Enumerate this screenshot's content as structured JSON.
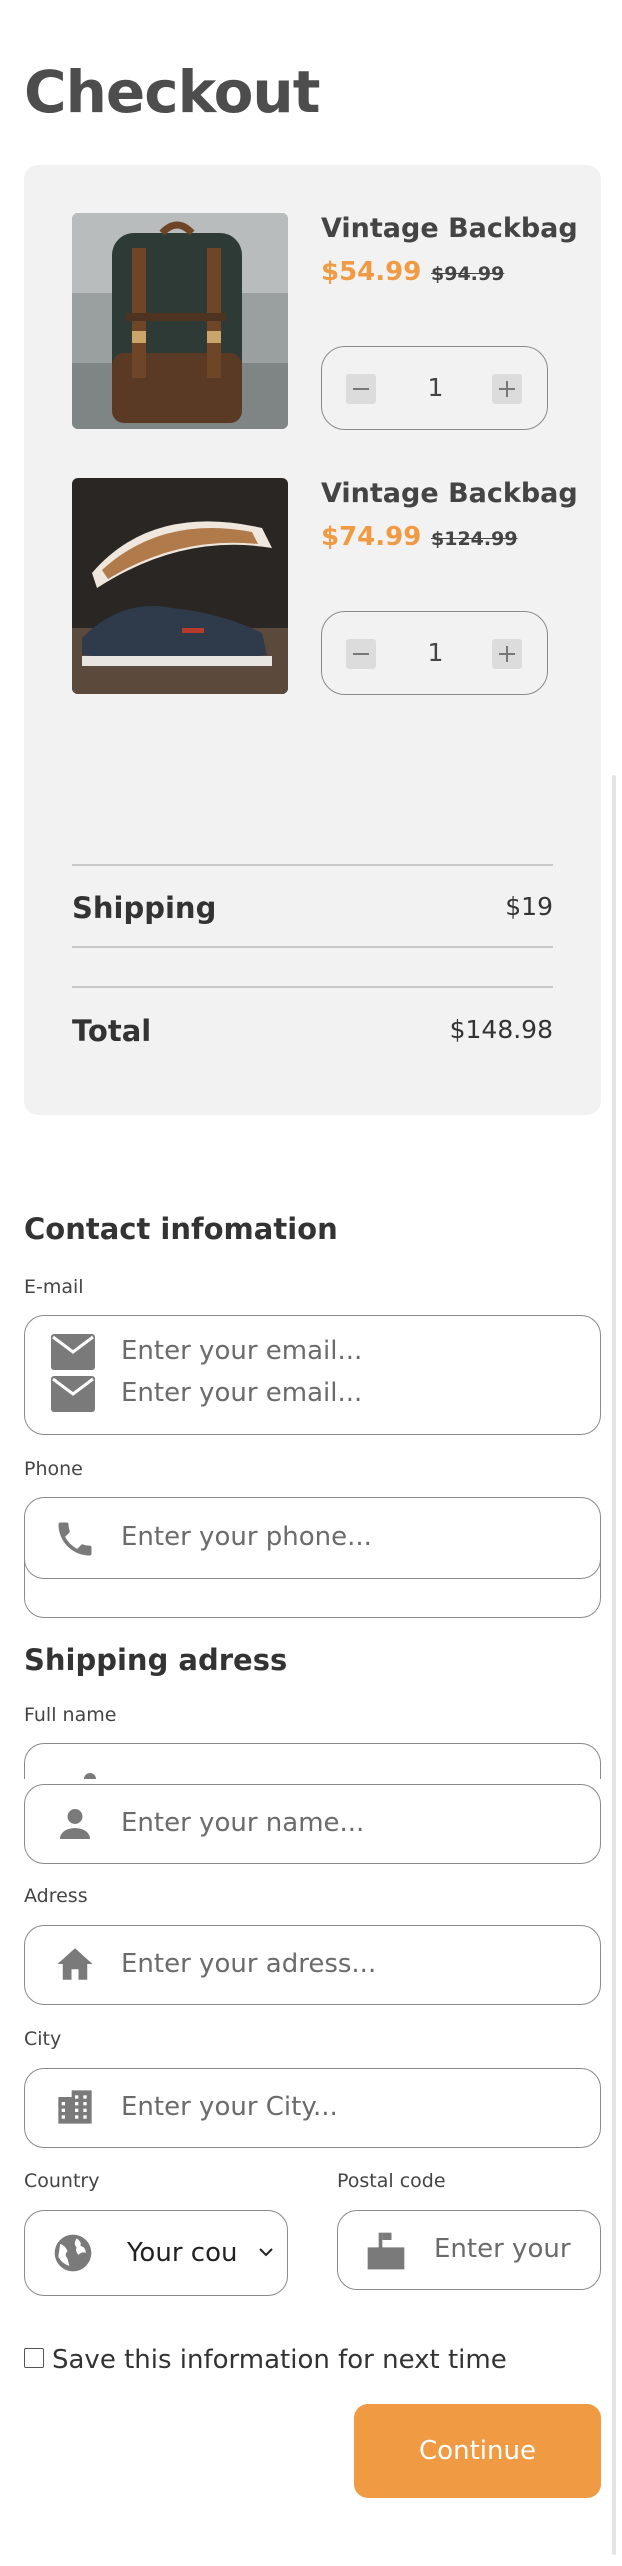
{
  "page": {
    "title": "Checkout"
  },
  "cart": {
    "items": [
      {
        "name": "Vintage Backbag",
        "price": "$54.99",
        "old_price": "$94.99",
        "quantity": "1",
        "image": "green-leather-backpack-photo"
      },
      {
        "name": "Vintage Backbag",
        "price": "$74.99",
        "old_price": "$124.99",
        "quantity": "1",
        "image": "navy-sneaker-photo"
      }
    ],
    "shipping_label": "Shipping",
    "shipping_value": "$19",
    "total_label": "Total",
    "total_value": "$148.98"
  },
  "contact": {
    "title": "Contact infomation",
    "email_label": "E-mail",
    "email_placeholder": "Enter your email...",
    "phone_label": "Phone",
    "phone_placeholder": "Enter your phone..."
  },
  "shipping": {
    "title": "Shipping adress",
    "name_label": "Full name",
    "name_placeholder": "Enter your name...",
    "address_label": "Adress",
    "address_placeholder": "Enter your adress...",
    "city_label": "City",
    "city_placeholder": "Enter your City...",
    "country_label": "Country",
    "country_value": "Your cou",
    "postal_label": "Postal code",
    "postal_placeholder": "Enter your"
  },
  "save_info_label": "Save this information for next time",
  "continue_label": "Continue",
  "icons": [
    "minus-icon",
    "plus-icon",
    "mail-icon",
    "phone-icon",
    "person-icon",
    "home-icon",
    "building-icon",
    "globe-icon",
    "mailbox-icon",
    "chevron-down-icon"
  ],
  "colors": {
    "accent": "#f09a43",
    "card": "#f2f2f2",
    "text": "#333333",
    "icon": "#7a7a7a"
  }
}
